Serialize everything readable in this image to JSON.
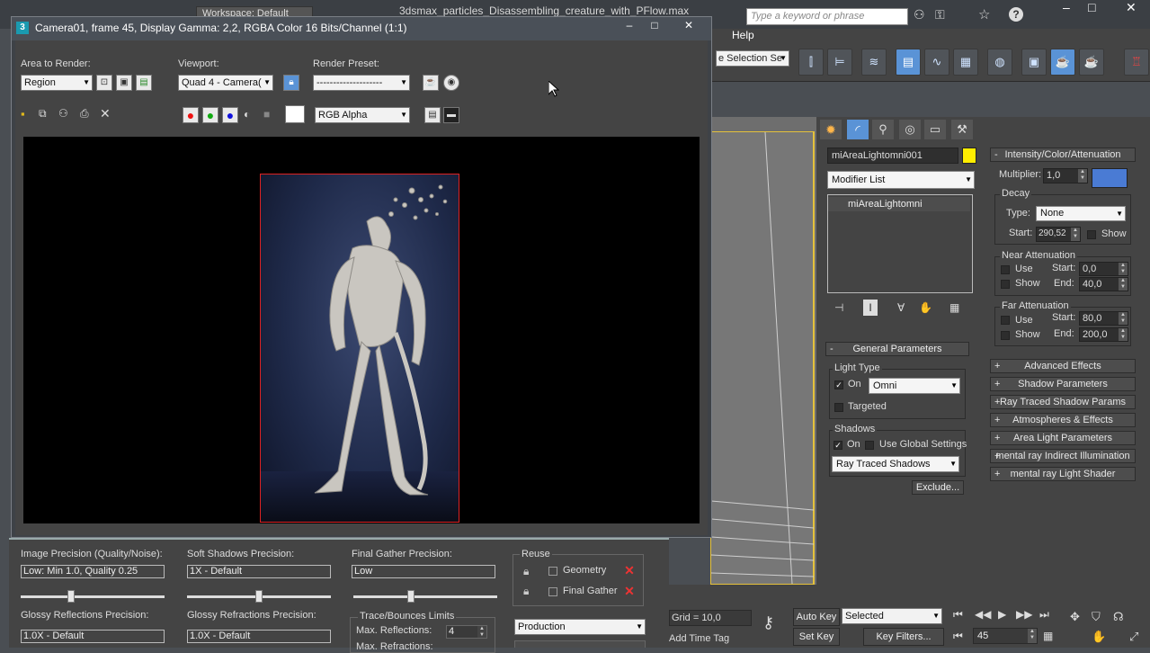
{
  "app": {
    "workspace_label": "Workspace: Default",
    "file_title": "3dsmax_particles_Disassembling_creature_with_PFlow.max",
    "search_placeholder": "Type a keyword or phrase",
    "help_menu": "Help",
    "selection_set_label": "e Selection Se",
    "window_controls": [
      "–",
      "□",
      "✕"
    ]
  },
  "render_window": {
    "title": "Camera01, frame 45, Display Gamma: 2,2, RGBA Color 16 Bits/Channel (1:1)",
    "area_to_render_label": "Area to Render:",
    "area_to_render_value": "Region",
    "viewport_label": "Viewport:",
    "viewport_value": "Quad 4 - Camera(",
    "render_preset_label": "Render Preset:",
    "render_preset_value": "--------------------",
    "channel_value": "RGB Alpha",
    "controls": [
      "–",
      "□",
      "✕"
    ]
  },
  "render_settings": {
    "image_precision_label": "Image Precision (Quality/Noise):",
    "image_precision_value": "Low: Min 1.0, Quality 0.25",
    "image_precision_slider": 0.35,
    "soft_shadows_label": "Soft Shadows Precision:",
    "soft_shadows_value": "1X - Default",
    "soft_shadows_slider": 0.5,
    "final_gather_label": "Final Gather Precision:",
    "final_gather_value": "Low",
    "final_gather_slider": 0.4,
    "reuse_label": "Reuse",
    "reuse_geometry": "Geometry",
    "reuse_final_gather": "Final Gather",
    "glossy_reflections_label": "Glossy Reflections Precision:",
    "glossy_reflections_value": "1.0X - Default",
    "glossy_refractions_label": "Glossy Refractions Precision:",
    "glossy_refractions_value": "1.0X - Default",
    "trace_label": "Trace/Bounces Limits",
    "max_reflections_label": "Max. Reflections:",
    "max_reflections_value": "4",
    "max_refractions_label": "Max. Refractions:",
    "production_value": "Production"
  },
  "command_panel": {
    "object_name": "miAreaLightomni001",
    "object_color": "#ffee00",
    "modifier_list": "Modifier List",
    "stack_item": "miAreaLightomni",
    "general_parameters": "General Parameters",
    "light_type_label": "Light Type",
    "light_on_label": "On",
    "light_type_value": "Omni",
    "targeted_label": "Targeted",
    "shadows_label": "Shadows",
    "shadows_on_label": "On",
    "use_global_label": "Use Global Settings",
    "shadow_type_value": "Ray Traced Shadows",
    "exclude_label": "Exclude...",
    "intensity_title": "Intensity/Color/Attenuation",
    "multiplier_label": "Multiplier:",
    "multiplier_value": "1,0",
    "multiplier_color": "#4a7bd4",
    "decay_label": "Decay",
    "decay_type_label": "Type:",
    "decay_type_value": "None",
    "decay_start_label": "Start:",
    "decay_start_value": "290,52",
    "decay_show_label": "Show",
    "near_atten_label": "Near Attenuation",
    "near_use": "Use",
    "near_show": "Show",
    "near_start_label": "Start:",
    "near_start_value": "0,0",
    "near_end_label": "End:",
    "near_end_value": "40,0",
    "far_atten_label": "Far Attenuation",
    "far_use": "Use",
    "far_show": "Show",
    "far_start_label": "Start:",
    "far_start_value": "80,0",
    "far_end_label": "End:",
    "far_end_value": "200,0",
    "rollouts": [
      "Advanced Effects",
      "Shadow Parameters",
      "Ray Traced Shadow Params",
      "Atmospheres & Effects",
      "Area Light Parameters",
      "mental ray Indirect Illumination",
      "mental ray Light Shader"
    ]
  },
  "animation": {
    "grid_label": "Grid = 10,0",
    "add_time_tag": "Add Time Tag",
    "auto_key": "Auto Key",
    "set_key": "Set Key",
    "selected_value": "Selected",
    "key_filters": "Key Filters...",
    "frame_value": "45"
  }
}
